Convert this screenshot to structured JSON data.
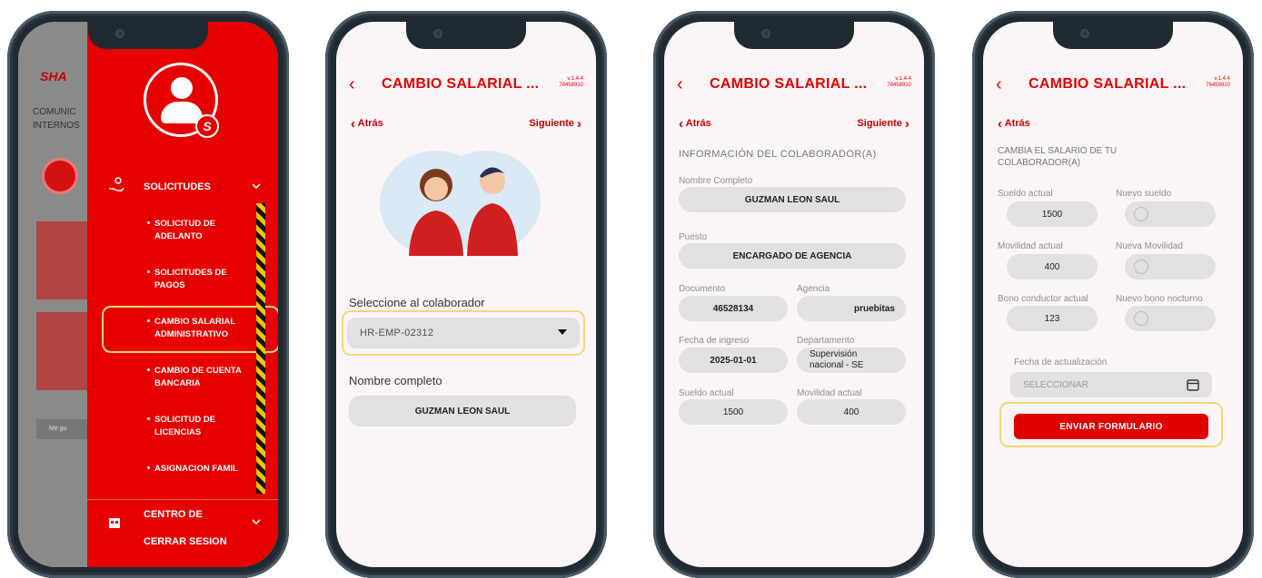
{
  "phone1": {
    "bg_logo": "SHA",
    "bg_comm": [
      "COMUNIC",
      "INTERNOS"
    ],
    "bg_bottom": "Me gu",
    "menu_header": "SOLICITUDES",
    "items": [
      [
        "SOLICITUD DE",
        "ADELANTO"
      ],
      [
        "SOLICITUDES DE",
        "PAGOS"
      ],
      [
        "CAMBIO SALARIAL",
        "ADMINISTRATIVO"
      ],
      [
        "CAMBIO DE CUENTA",
        "BANCARIA"
      ],
      [
        "SOLICITUD DE",
        "LICENCIAS"
      ],
      [
        "ASIGNACION FAMIL"
      ]
    ],
    "centro": "CENTRO DE",
    "logout": "CERRAR SESION"
  },
  "header": {
    "back": "‹",
    "title": "CAMBIO SALARIAL ...",
    "version": "v.1.4.4",
    "code": "76458910"
  },
  "nav": {
    "prev": "Atrás",
    "next": "Siguiente"
  },
  "phone2": {
    "select_label": "Seleccione al colaborador",
    "select_value": "HR-EMP-02312",
    "name_label": "Nombre completo",
    "name_value": "GUZMAN LEON SAUL"
  },
  "phone3": {
    "section": "INFORMACIÓN DEL COLABORADOR(A)",
    "fields": {
      "nombre_label": "Nombre Completo",
      "nombre": "GUZMAN LEON SAUL",
      "puesto_label": "Puesto",
      "puesto": "ENCARGADO DE AGENCIA",
      "documento_label": "Documento",
      "documento": "46528134",
      "agencia_label": "Agencia",
      "agencia": "pruebitas",
      "ingreso_label": "Fecha de ingreso",
      "ingreso": "2025-01-01",
      "depto_label": "Departamento",
      "depto_1": "Supervisión",
      "depto_2": "nacional  - SE",
      "sueldo_label": "Sueldo actual",
      "sueldo": "1500",
      "movilidad_label": "Movilidad actual",
      "movilidad": "400"
    }
  },
  "phone4": {
    "section_1": "CAMBIA EL SALARIO DE TU",
    "section_2": "COLABORADOR(A)",
    "sueldo_actual_label": "Sueldo actual",
    "sueldo_actual": "1500",
    "nuevo_sueldo_label": "Nuevo sueldo",
    "movilidad_actual_label": "Movilidad actual",
    "movilidad_actual": "400",
    "nueva_movilidad_label": "Nueva Movilidad",
    "bono_actual_label": "Bono conductor actual",
    "bono_actual": "123",
    "nuevo_bono_label": "Nuevo bono nocturno",
    "fecha_label": "Fecha de actualización",
    "fecha_placeholder": "SELECCIONAR",
    "submit": "ENVIAR FORMULARIO"
  },
  "colors": {
    "accent": "#e60000",
    "highlight": "#f3d77a"
  },
  "icons": [
    "chevron-left-icon",
    "chevron-right-icon",
    "user-icon",
    "calendar-icon",
    "chevron-down-icon",
    "hand-coins-icon",
    "building-icon"
  ]
}
